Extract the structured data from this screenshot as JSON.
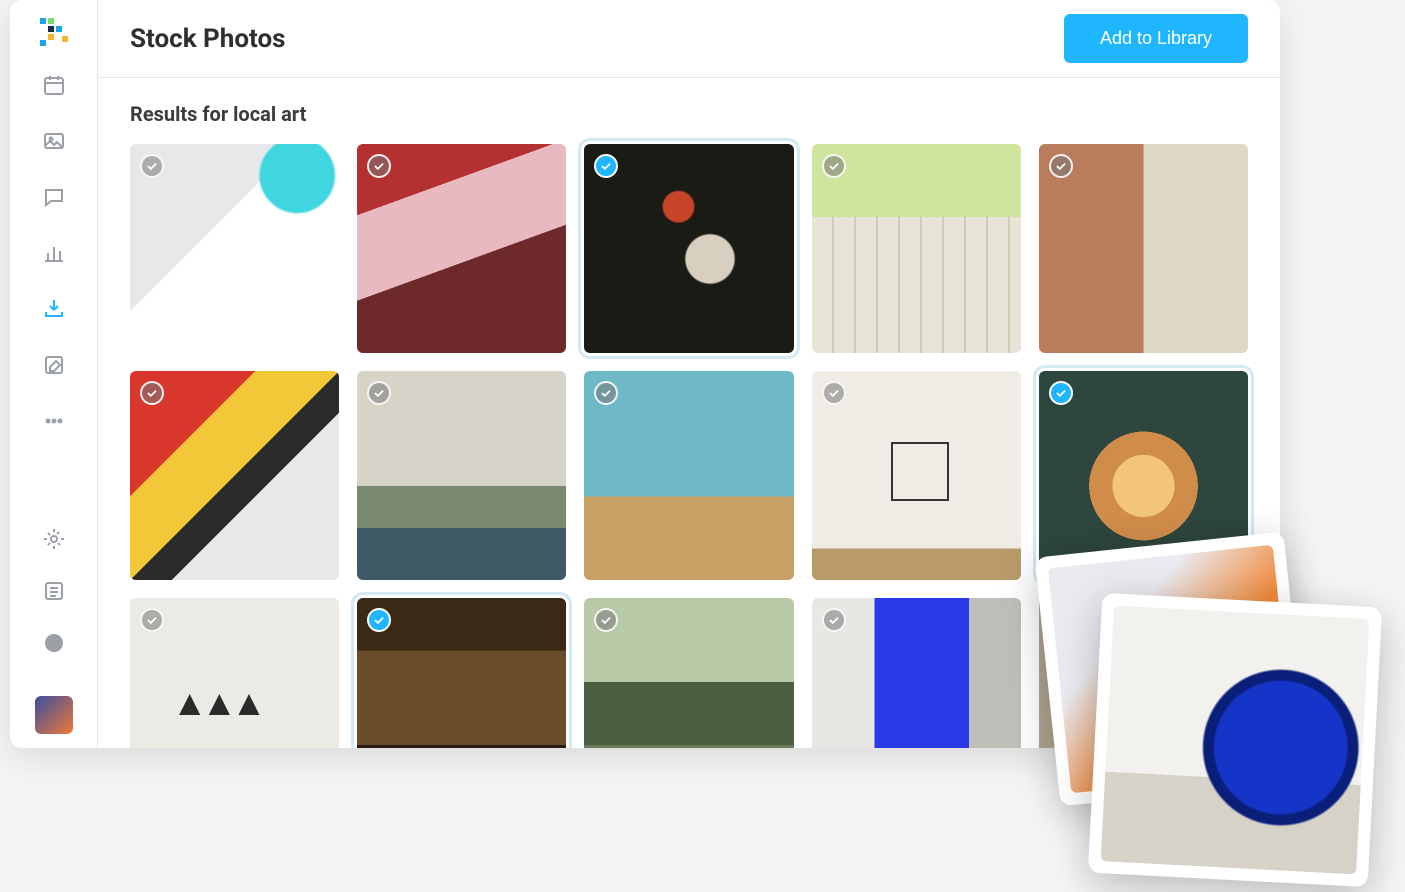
{
  "header": {
    "title": "Stock Photos",
    "primary_action": "Add to Library"
  },
  "results": {
    "label": "Results for local art",
    "query": "local art"
  },
  "sidebar": {
    "items": [
      {
        "name": "calendar",
        "active": false
      },
      {
        "name": "gallery",
        "active": false
      },
      {
        "name": "chat",
        "active": false
      },
      {
        "name": "analytics",
        "active": false
      },
      {
        "name": "inbox",
        "active": true
      },
      {
        "name": "compose",
        "active": false
      },
      {
        "name": "more",
        "active": false
      }
    ],
    "bottom": [
      {
        "name": "settings"
      },
      {
        "name": "list"
      },
      {
        "name": "help"
      }
    ]
  },
  "thumbnails": [
    {
      "selected": false
    },
    {
      "selected": false
    },
    {
      "selected": true
    },
    {
      "selected": false
    },
    {
      "selected": false
    },
    {
      "selected": false
    },
    {
      "selected": false
    },
    {
      "selected": false
    },
    {
      "selected": false
    },
    {
      "selected": true
    },
    {
      "selected": false
    },
    {
      "selected": true
    },
    {
      "selected": false
    },
    {
      "selected": false
    },
    {
      "selected": false
    }
  ],
  "colors": {
    "accent": "#1fb6ff"
  }
}
